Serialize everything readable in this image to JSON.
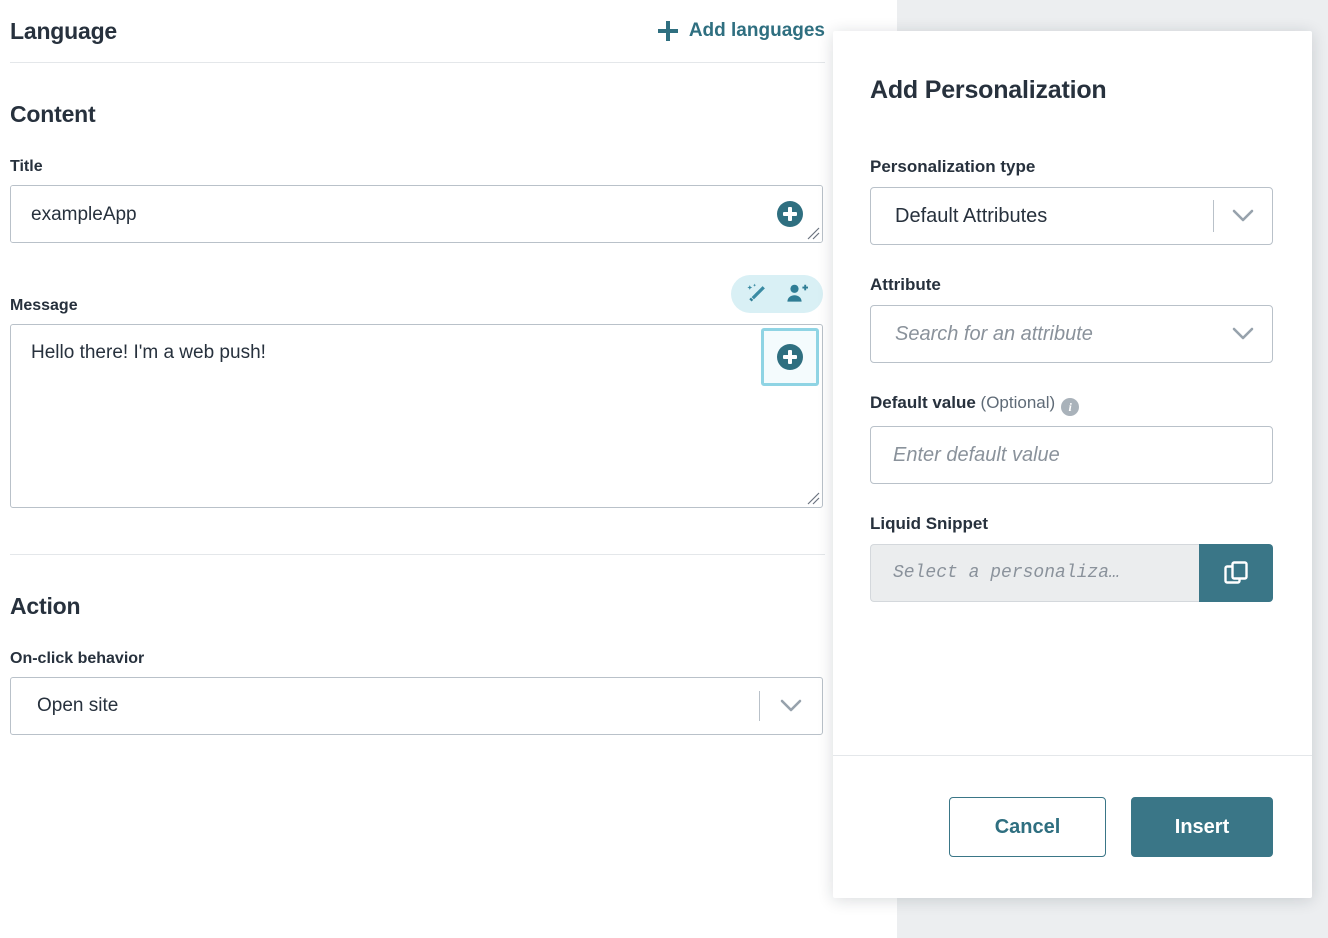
{
  "editor": {
    "language_section": {
      "title": "Language",
      "add_languages_label": "Add languages",
      "add_icon": "plus-icon"
    },
    "content_section": {
      "heading": "Content",
      "title_field": {
        "label": "Title",
        "value": "exampleApp",
        "personalization_icon": "circle-plus-icon"
      },
      "message_field": {
        "label": "Message",
        "value": "Hello there! I'm a web push!",
        "ai_icon": "magic-wand-icon",
        "personalization_toolbar_icon": "person-plus-icon",
        "personalization_icon": "circle-plus-icon"
      }
    },
    "action_section": {
      "heading": "Action",
      "onclick_field": {
        "label": "On-click behavior",
        "value": "Open site",
        "chevron_icon": "chevron-down-icon"
      }
    }
  },
  "modal": {
    "title": "Add Personalization",
    "personalization_type": {
      "label": "Personalization type",
      "value": "Default Attributes",
      "chevron_icon": "chevron-down-icon"
    },
    "attribute": {
      "label": "Attribute",
      "placeholder": "Search for an attribute",
      "value": "",
      "chevron_icon": "chevron-down-icon"
    },
    "default_value": {
      "label": "Default value",
      "optional_suffix": "(Optional)",
      "info_icon": "info-icon",
      "placeholder": "Enter default value",
      "value": ""
    },
    "liquid_snippet": {
      "label": "Liquid Snippet",
      "placeholder": "Select a personaliza…",
      "value": "",
      "copy_icon": "copy-icon"
    },
    "footer": {
      "cancel_label": "Cancel",
      "insert_label": "Insert"
    }
  },
  "colors": {
    "accent_teal": "#3a7687",
    "link_teal": "#2f6f80",
    "focus_ring": "#8fd4e4",
    "pill_bg": "#d9f0f5",
    "text_dark": "#27313d",
    "border_gray": "#b9c1c9",
    "backdrop_gray": "#eceef0"
  }
}
